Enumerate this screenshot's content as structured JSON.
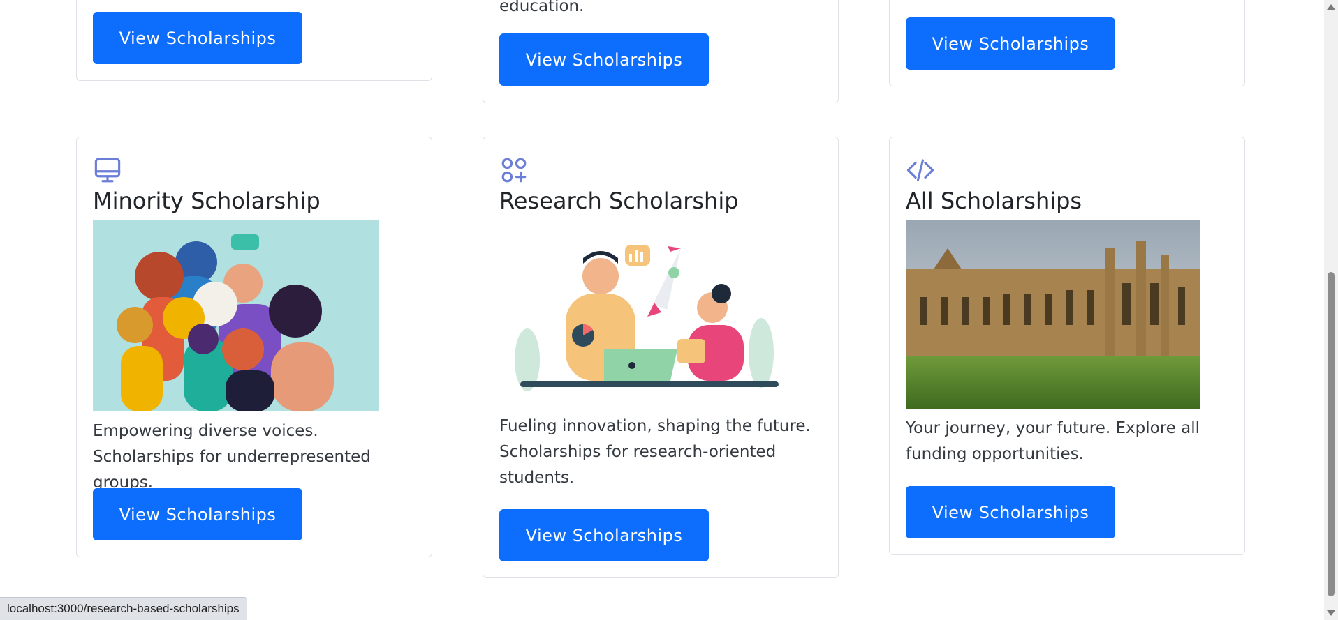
{
  "top_row": {
    "card1": {
      "button": "View Scholarships"
    },
    "card2": {
      "text_fragment": "education.",
      "button": "View Scholarships"
    },
    "card3": {
      "button": "View Scholarships"
    }
  },
  "cards": [
    {
      "icon": "monitor-icon",
      "title": "Minority Scholarship",
      "description": "Empowering diverse voices. Scholarships for underrepresented groups.",
      "button": "View Scholarships"
    },
    {
      "icon": "grid-plus-icon",
      "title": "Research Scholarship",
      "description": "Fueling innovation, shaping the future. Scholarships for research-oriented students.",
      "button": "View Scholarships"
    },
    {
      "icon": "code-icon",
      "title": "All Scholarships",
      "description": "Your journey, your future. Explore all funding opportunities.",
      "button": "View Scholarships"
    }
  ],
  "status_bar": {
    "url": "localhost:3000/research-based-scholarships"
  },
  "colors": {
    "primary": "#0d6efd",
    "icon": "#6c7fd8",
    "border": "#dee2e6"
  }
}
